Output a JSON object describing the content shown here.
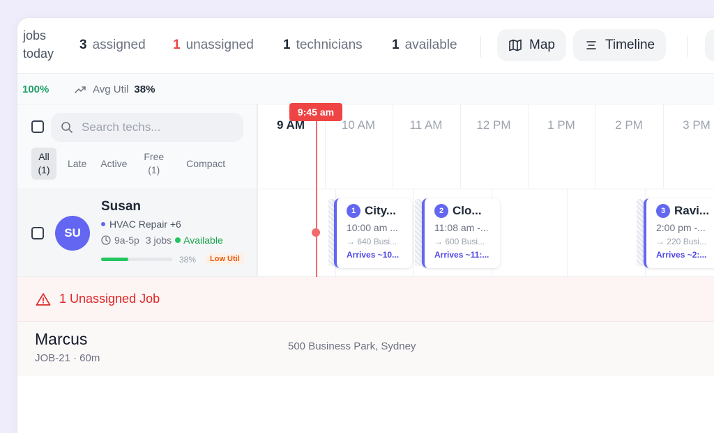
{
  "topbar": {
    "jobs_today_label": "jobs today",
    "stats": [
      {
        "num": "3",
        "label": "assigned"
      },
      {
        "num": "1",
        "label": "unassigned"
      },
      {
        "num": "1",
        "label": "technicians"
      },
      {
        "num": "1",
        "label": "available"
      }
    ],
    "map_label": "Map",
    "timeline_label": "Timeline"
  },
  "util": {
    "pct": "100%",
    "avg_label": "Avg Util",
    "avg_value": "38%"
  },
  "search": {
    "placeholder": "Search techs..."
  },
  "filters": [
    {
      "label": "All",
      "count": "(1)"
    },
    {
      "label": "Late",
      "count": ""
    },
    {
      "label": "Active",
      "count": ""
    },
    {
      "label": "Free",
      "count": "(1)"
    },
    {
      "label": "Compact",
      "count": ""
    }
  ],
  "timeline": {
    "hours": [
      "9 AM",
      "10 AM",
      "11 AM",
      "12 PM",
      "1 PM",
      "2 PM",
      "3 PM"
    ],
    "now": "9:45 am"
  },
  "tech": {
    "initials": "SU",
    "name": "Susan",
    "skill": "HVAC Repair +6",
    "hours": "9a-5p",
    "jobs": "3 jobs",
    "status": "Available",
    "util_fraction": 0.38,
    "util_pct": "38%",
    "util_badge": "Low Util"
  },
  "jobs": [
    {
      "n": "1",
      "title": "City...",
      "time": "10:00 am ...",
      "addr": "→ 640 Busi...",
      "arrives": "Arrives ~10..."
    },
    {
      "n": "2",
      "title": "Clo...",
      "time": "11:08 am -...",
      "addr": "→ 600 Busi...",
      "arrives": "Arrives ~11:..."
    },
    {
      "n": "3",
      "title": "Ravi...",
      "time": "2:00 pm -...",
      "addr": "→ 220 Busi...",
      "arrives": "Arrives ~2:..."
    }
  ],
  "unassigned": {
    "header": "1 Unassigned Job",
    "name": "Marcus",
    "job": "JOB-21 · 60m",
    "address": "500 Business Park, Sydney"
  },
  "colors": {
    "accent": "#6366f1",
    "danger": "#ef4444",
    "success": "#22c55e"
  }
}
